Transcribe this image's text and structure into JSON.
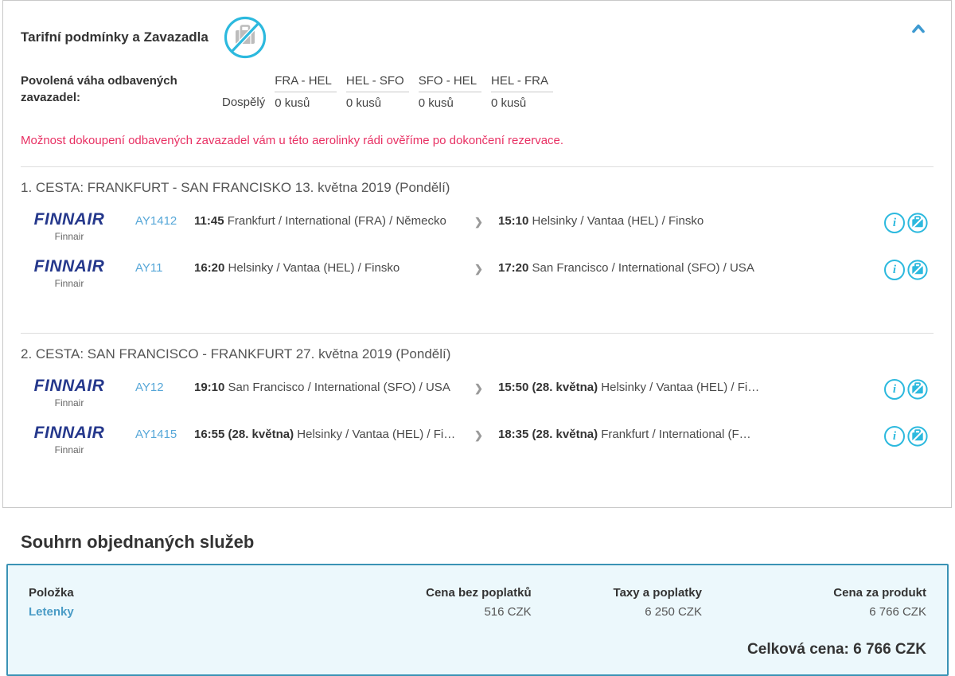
{
  "fare_card": {
    "title": "Tarifní podmínky a Zavazadla",
    "baggage": {
      "label": "Povolená váha odbavených zavazadel:",
      "row_label": "Dospělý",
      "segments": [
        "FRA - HEL",
        "HEL - SFO",
        "SFO - HEL",
        "HEL - FRA"
      ],
      "values": [
        "0 kusů",
        "0 kusů",
        "0 kusů",
        "0 kusů"
      ]
    },
    "notice": "Možnost dokoupení odbavených zavazadel vám u této aerolinky rádi ověříme po dokončení rezervace."
  },
  "airline": {
    "logo_text": "FINNAIR",
    "name": "Finnair"
  },
  "journeys": [
    {
      "title": "1. CESTA: FRANKFURT - SAN FRANCISKO 13. května 2019 (Pondělí)",
      "flights": [
        {
          "flight_no": "AY1412",
          "dep_time": "11:45",
          "dep_date": "",
          "dep_place": "Frankfurt / International (FRA) / Německo",
          "arr_time": "15:10",
          "arr_date": "",
          "arr_place": "Helsinky / Vantaa (HEL) / Finsko"
        },
        {
          "flight_no": "AY11",
          "dep_time": "16:20",
          "dep_date": "",
          "dep_place": "Helsinky / Vantaa (HEL) / Finsko",
          "arr_time": "17:20",
          "arr_date": "",
          "arr_place": "San Francisco / International (SFO) / USA"
        }
      ]
    },
    {
      "title": "2. CESTA: SAN FRANCISCO - FRANKFURT 27. května 2019 (Pondělí)",
      "flights": [
        {
          "flight_no": "AY12",
          "dep_time": "19:10",
          "dep_date": "",
          "dep_place": "San Francisco / International (SFO) / USA",
          "arr_time": "15:50",
          "arr_date": "(28. května)",
          "arr_place": "Helsinky / Vantaa (HEL) / Fi…"
        },
        {
          "flight_no": "AY1415",
          "dep_time": "16:55",
          "dep_date": "(28. května)",
          "dep_place": "Helsinky / Vantaa (HEL) / Fi…",
          "arr_time": "18:35",
          "arr_date": "(28. května)",
          "arr_place": "Frankfurt / International (F…"
        }
      ]
    }
  ],
  "summary": {
    "heading": "Souhrn objednaných služeb",
    "columns": [
      "Položka",
      "Cena bez poplatků",
      "Taxy a poplatky",
      "Cena za produkt"
    ],
    "row": {
      "item": "Letenky",
      "price_net": "516 CZK",
      "taxes": "6 250 CZK",
      "price_total": "6 766 CZK"
    },
    "total_label": "Celková cena: 6 766 CZK"
  },
  "icons": {
    "info_glyph": "i",
    "segment_arrow": "❯"
  },
  "colors": {
    "accent_cyan": "#2cb9de",
    "flight_no_blue": "#56a7d8",
    "notice_pink": "#e83063",
    "airline_navy": "#25388c",
    "summary_border": "#3a93b5",
    "summary_bg": "#ecf8fc",
    "item_link": "#4a9cc6",
    "collapse_chevron": "#3d9ad1"
  }
}
